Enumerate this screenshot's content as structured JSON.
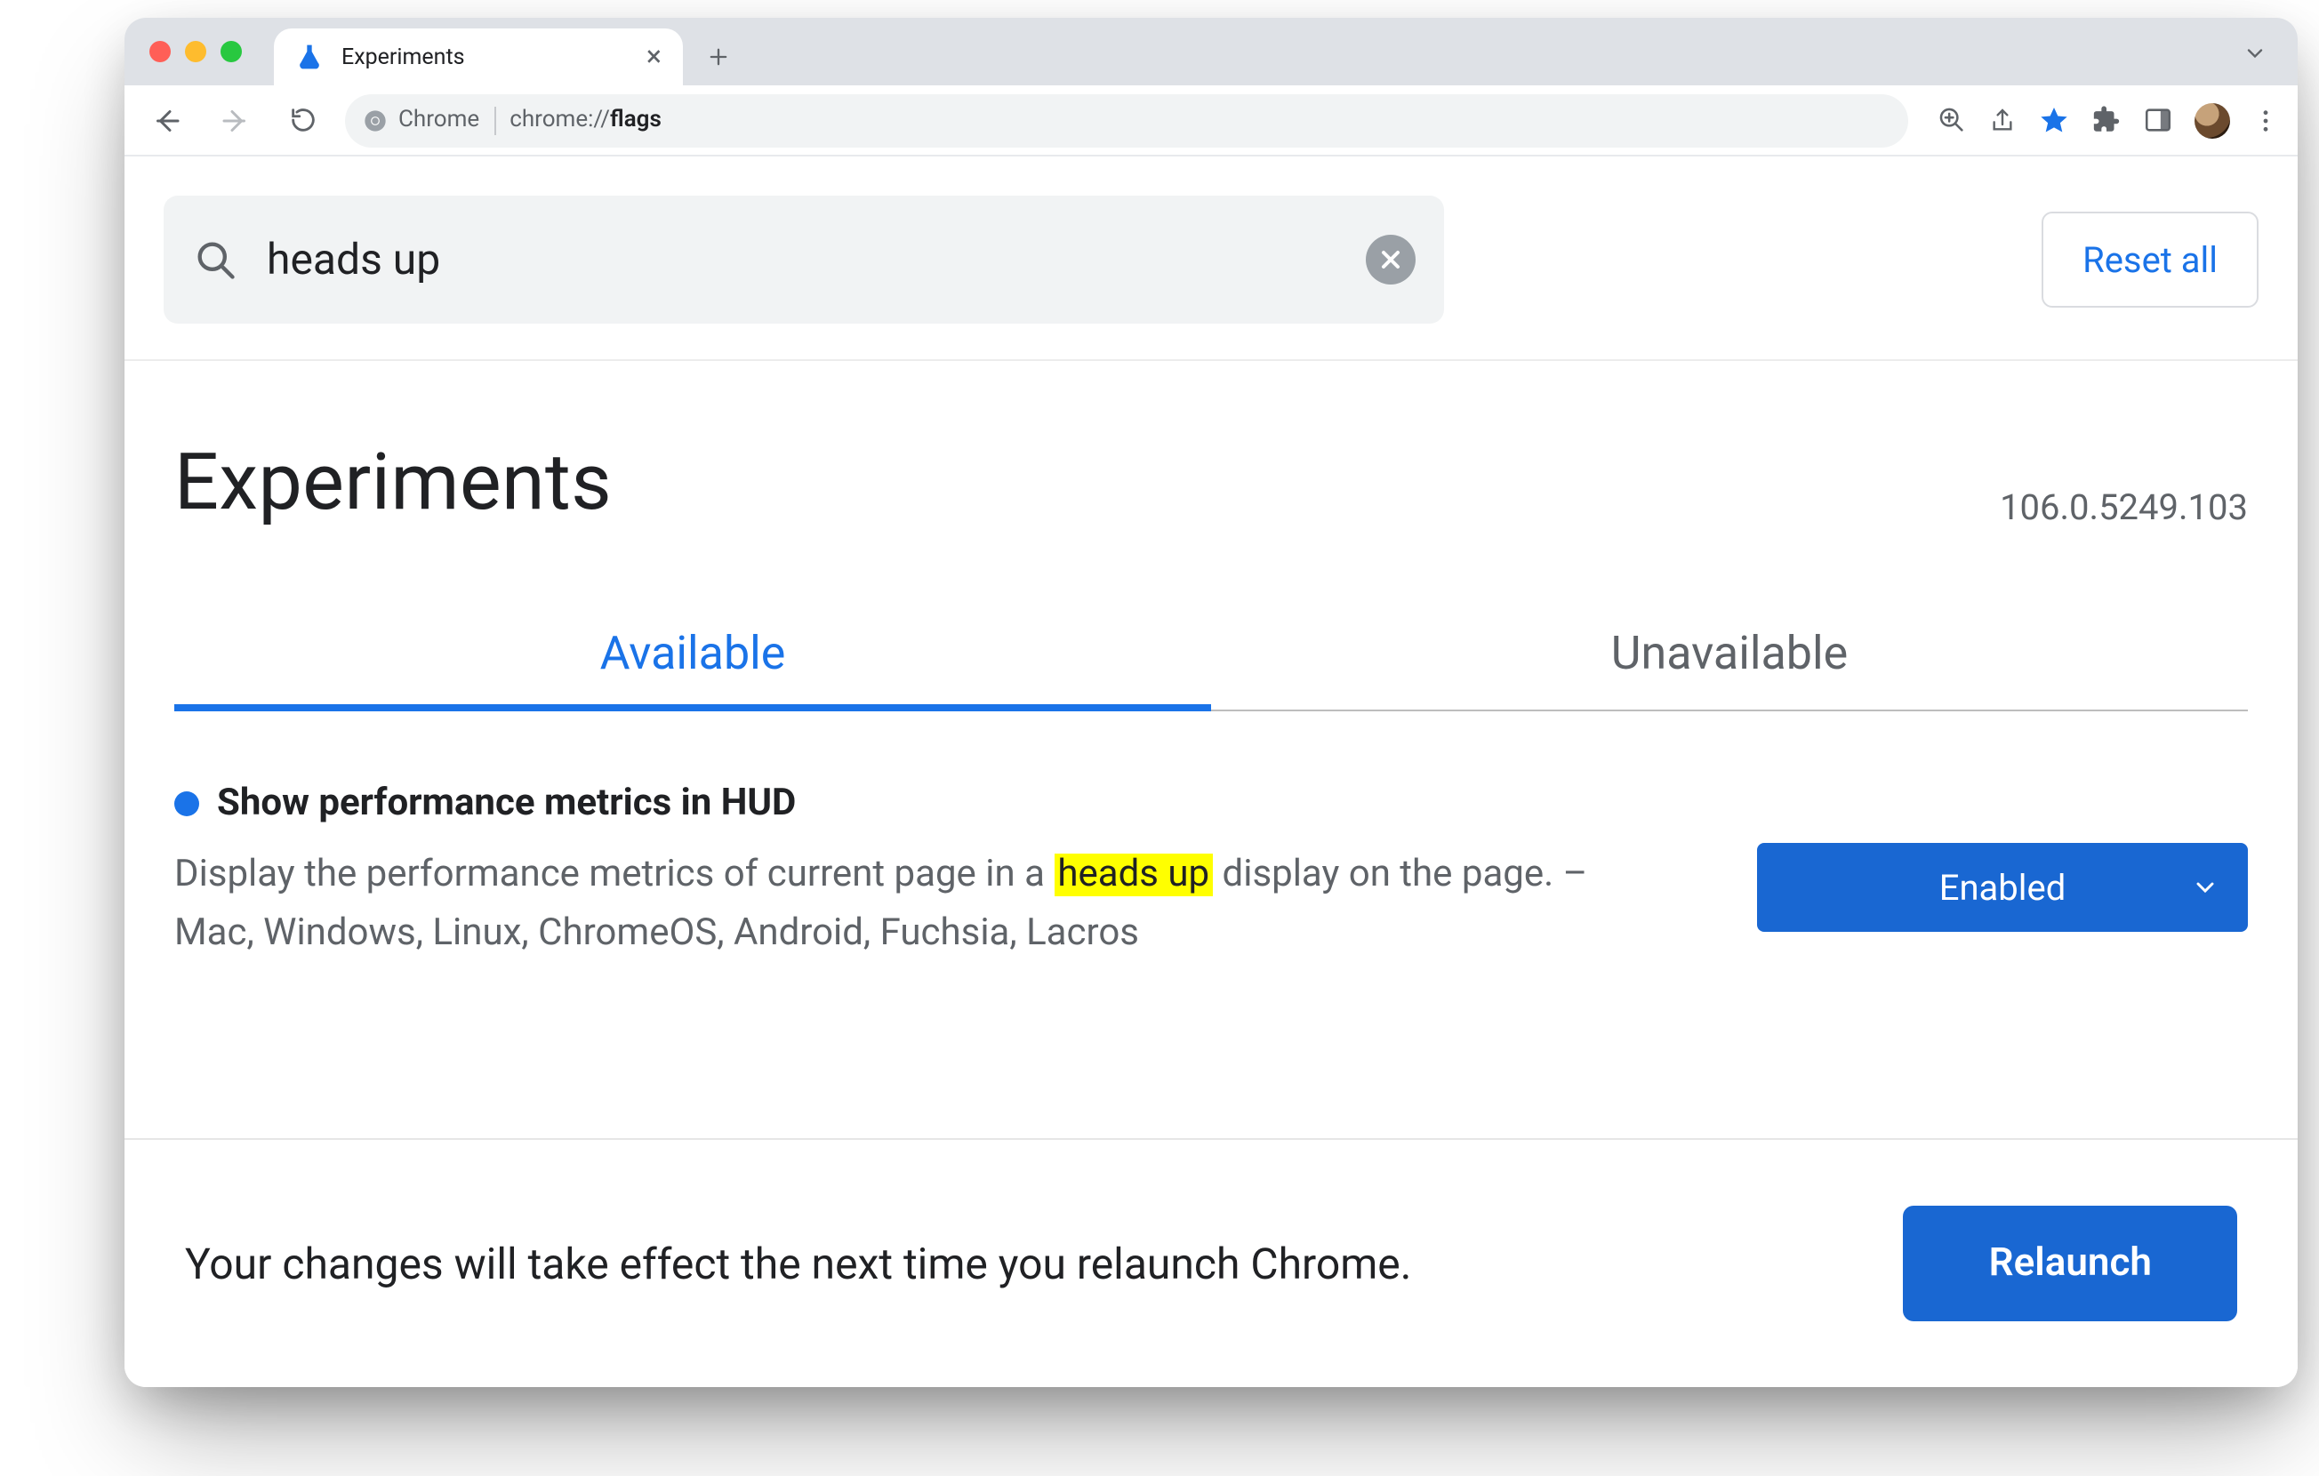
{
  "window": {
    "tab_title": "Experiments",
    "address_prefix": "Chrome",
    "address_scheme": "chrome://",
    "address_path": "flags"
  },
  "search": {
    "value": "heads up",
    "reset_label": "Reset all"
  },
  "page": {
    "heading": "Experiments",
    "version": "106.0.5249.103"
  },
  "tabs": {
    "available": "Available",
    "unavailable": "Unavailable"
  },
  "flag": {
    "title": "Show performance metrics in HUD",
    "desc_before": "Display the performance metrics of current page in a ",
    "desc_highlight": "heads up",
    "desc_after": " display on the page. – Mac, Windows, Linux, ChromeOS, Android, Fuchsia, Lacros",
    "select_value": "Enabled"
  },
  "footer": {
    "message": "Your changes will take effect the next time you relaunch Chrome.",
    "relaunch_label": "Relaunch"
  }
}
